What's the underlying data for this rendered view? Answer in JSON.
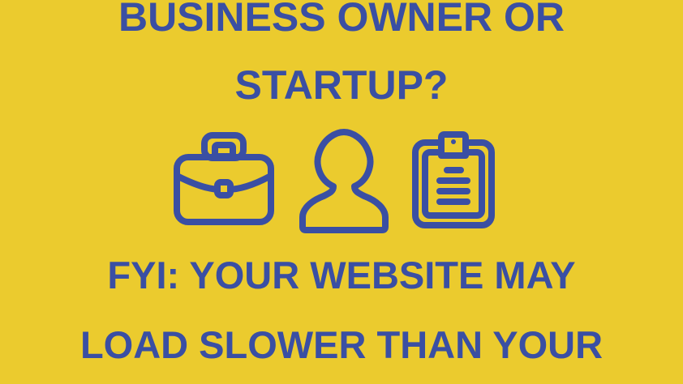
{
  "headline": {
    "line1": "BUSINESS OWNER OR",
    "line2": "STARTUP?"
  },
  "icons": [
    "briefcase-icon",
    "person-icon",
    "clipboard-icon"
  ],
  "message": {
    "line1": "FYI: YOUR WEBSITE MAY",
    "line2": "LOAD SLOWER THAN YOUR"
  },
  "colors": {
    "background": "#EBCB2E",
    "text": "#3A4FA3"
  }
}
